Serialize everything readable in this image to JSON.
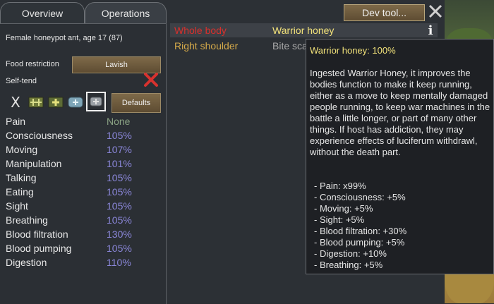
{
  "tabs": [
    "Overview",
    "Operations"
  ],
  "pawn": {
    "description": "Female honeypot ant, age 17 (87)"
  },
  "food_restriction": {
    "label": "Food restriction",
    "value": "Lavish"
  },
  "self_tend": {
    "label": "Self-tend",
    "icon": "red-x-icon"
  },
  "medicine": {
    "options": [
      "no-care-icon",
      "herbal-medicine-icon",
      "industrial-medicine-icon",
      "glitterworld-medicine-icon",
      "no-meds-icon"
    ],
    "none_glyph": "X",
    "defaults_label": "Defaults"
  },
  "capacities": [
    {
      "name": "Pain",
      "value": "None"
    },
    {
      "name": "Consciousness",
      "value": "105%"
    },
    {
      "name": "Moving",
      "value": "107%"
    },
    {
      "name": "Manipulation",
      "value": "101%"
    },
    {
      "name": "Talking",
      "value": "105%"
    },
    {
      "name": "Eating",
      "value": "105%"
    },
    {
      "name": "Sight",
      "value": "105%"
    },
    {
      "name": "Breathing",
      "value": "105%"
    },
    {
      "name": "Blood filtration",
      "value": "130%"
    },
    {
      "name": "Blood pumping",
      "value": "105%"
    },
    {
      "name": "Digestion",
      "value": "110%"
    }
  ],
  "health_rows": [
    {
      "part": "Whole body",
      "part_color": "#d9302c",
      "hediff": "Warrior honey",
      "hediff_color": "#f2e27a"
    },
    {
      "part": "Right shoulder",
      "part_color": "#d4a94a",
      "hediff": "Bite sca",
      "hediff_color": "#a9a9a9"
    }
  ],
  "dev_tool_label": "Dev tool...",
  "info_glyph": "i",
  "tooltip": {
    "title": "Warrior honey: 100%",
    "description": "Ingested Warrior Honey, it improves the bodies function to make it keep running, either as a move to keep mentally damaged people running, to keep war machines in the battle a little longer, or part of many other things. If host has addiction, they may experience effects of luciferum withdrawl, without the death part.",
    "effects": [
      "- Pain: x99%",
      "- Consciousness: +5%",
      "- Moving: +5%",
      "- Sight: +5%",
      "- Blood filtration: +30%",
      "- Blood pumping: +5%",
      "- Digestion: +10%",
      "- Breathing: +5%"
    ]
  },
  "colors": {
    "percent_value": "#8a86d8",
    "none_value": "#8aa283",
    "tooltip_title": "#f2e27a",
    "button_brown": "#6e5b3d"
  }
}
